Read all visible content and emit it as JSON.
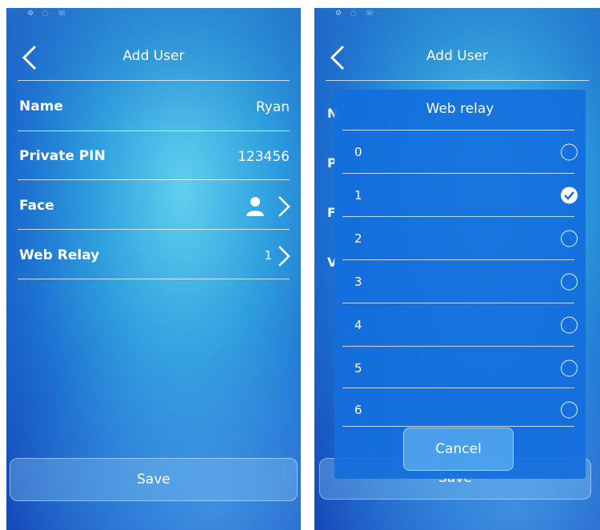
{
  "left_screen": {
    "header": {
      "title": "Add User"
    },
    "rows": [
      {
        "label": "Name",
        "value": "Ryan"
      },
      {
        "label": "Private PIN",
        "value": "123456"
      },
      {
        "label": "Face",
        "value": ""
      },
      {
        "label": "Web Relay",
        "value": "1"
      }
    ],
    "save_label": "Save"
  },
  "right_screen": {
    "header": {
      "title": "Add User"
    },
    "peek_letters": [
      "N",
      "P",
      "F",
      "V"
    ],
    "save_label": "Save",
    "dialog": {
      "title": "Web relay",
      "options": [
        "0",
        "1",
        "2",
        "3",
        "4",
        "5",
        "6"
      ],
      "selected": "1",
      "cancel_label": "Cancel"
    }
  },
  "colors": {
    "accent": "#1c6fd0",
    "text": "#ffffff"
  },
  "icons": [
    "back-chevron-icon",
    "person-icon",
    "chevron-right-icon",
    "radio-icon",
    "checkmark-icon"
  ]
}
